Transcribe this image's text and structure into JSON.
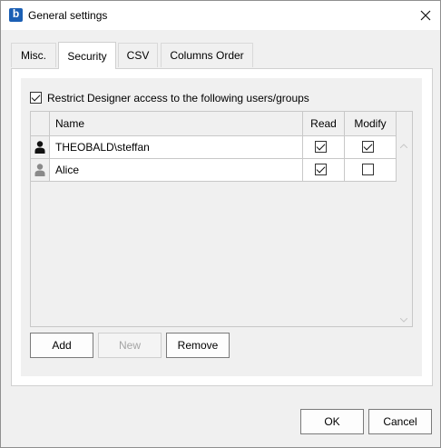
{
  "window": {
    "title": "General settings",
    "app_icon_letter": "b"
  },
  "tabs": [
    {
      "label": "Misc.",
      "active": false
    },
    {
      "label": "Security",
      "active": true
    },
    {
      "label": "CSV",
      "active": false
    },
    {
      "label": "Columns Order",
      "active": false
    }
  ],
  "security": {
    "restrict_label": "Restrict Designer access to the following users/groups",
    "restrict_checked": true,
    "columns": {
      "name": "Name",
      "read": "Read",
      "modify": "Modify"
    },
    "rows": [
      {
        "name": "THEOBALD\\steffan",
        "read": true,
        "modify": true,
        "icon": "user-icon"
      },
      {
        "name": "Alice",
        "read": true,
        "modify": false,
        "icon": "user-icon-gray"
      }
    ],
    "buttons": {
      "add": "Add",
      "new": "New",
      "remove": "Remove"
    }
  },
  "footer": {
    "ok": "OK",
    "cancel": "Cancel"
  },
  "colors": {
    "accent": "#1b5fb4"
  }
}
